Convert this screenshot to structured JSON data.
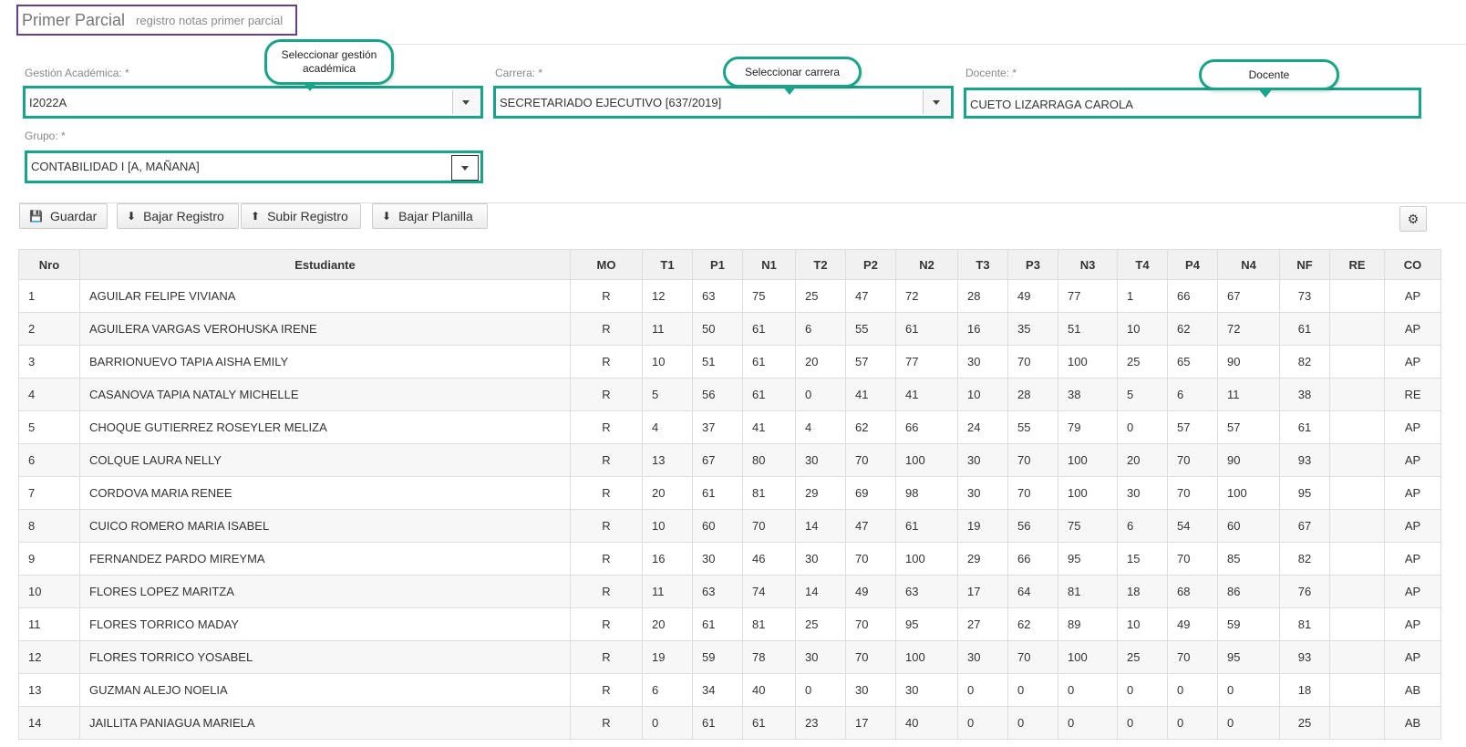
{
  "header": {
    "title": "Primer Parcial",
    "subtitle": "registro notas primer parcial"
  },
  "form": {
    "gestion": {
      "label": "Gestión Académica:  *",
      "value": "I2022A"
    },
    "carrera": {
      "label": "Carrera:  *",
      "value": "SECRETARIADO EJECUTIVO [637/2019]"
    },
    "docente": {
      "label": "Docente:  *",
      "value": "CUETO LIZARRAGA  CAROLA"
    },
    "grupo": {
      "label": "Grupo:  *",
      "value": "CONTABILIDAD I [A, MAÑANA]"
    }
  },
  "callouts": {
    "gestion": "Seleccionar gestión académica",
    "carrera": "Seleccionar carrera",
    "docente": "Docente"
  },
  "toolbar": {
    "guardar": "Guardar",
    "bajar_registro": "Bajar Registro",
    "subir_registro": "Subir Registro",
    "bajar_planilla": "Bajar Planilla"
  },
  "table": {
    "columns": [
      "Nro",
      "Estudiante",
      "MO",
      "T1",
      "P1",
      "N1",
      "T2",
      "P2",
      "N2",
      "T3",
      "P3",
      "N3",
      "T4",
      "P4",
      "N4",
      "NF",
      "RE",
      "CO"
    ],
    "rows": [
      [
        "1",
        "AGUILAR FELIPE VIVIANA",
        "R",
        "12",
        "63",
        "75",
        "25",
        "47",
        "72",
        "28",
        "49",
        "77",
        "1",
        "66",
        "67",
        "73",
        "",
        "AP"
      ],
      [
        "2",
        "AGUILERA VARGAS VEROHUSKA IRENE",
        "R",
        "11",
        "50",
        "61",
        "6",
        "55",
        "61",
        "16",
        "35",
        "51",
        "10",
        "62",
        "72",
        "61",
        "",
        "AP"
      ],
      [
        "3",
        "BARRIONUEVO TAPIA AISHA EMILY",
        "R",
        "10",
        "51",
        "61",
        "20",
        "57",
        "77",
        "30",
        "70",
        "100",
        "25",
        "65",
        "90",
        "82",
        "",
        "AP"
      ],
      [
        "4",
        "CASANOVA TAPIA NATALY MICHELLE",
        "R",
        "5",
        "56",
        "61",
        "0",
        "41",
        "41",
        "10",
        "28",
        "38",
        "5",
        "6",
        "11",
        "38",
        "",
        "RE"
      ],
      [
        "5",
        "CHOQUE GUTIERREZ ROSEYLER MELIZA",
        "R",
        "4",
        "37",
        "41",
        "4",
        "62",
        "66",
        "24",
        "55",
        "79",
        "0",
        "57",
        "57",
        "61",
        "",
        "AP"
      ],
      [
        "6",
        "COLQUE LAURA NELLY",
        "R",
        "13",
        "67",
        "80",
        "30",
        "70",
        "100",
        "30",
        "70",
        "100",
        "20",
        "70",
        "90",
        "93",
        "",
        "AP"
      ],
      [
        "7",
        "CORDOVA MARIA RENEE",
        "R",
        "20",
        "61",
        "81",
        "29",
        "69",
        "98",
        "30",
        "70",
        "100",
        "30",
        "70",
        "100",
        "95",
        "",
        "AP"
      ],
      [
        "8",
        "CUICO ROMERO MARIA ISABEL",
        "R",
        "10",
        "60",
        "70",
        "14",
        "47",
        "61",
        "19",
        "56",
        "75",
        "6",
        "54",
        "60",
        "67",
        "",
        "AP"
      ],
      [
        "9",
        "FERNANDEZ PARDO MIREYMA",
        "R",
        "16",
        "30",
        "46",
        "30",
        "70",
        "100",
        "29",
        "66",
        "95",
        "15",
        "70",
        "85",
        "82",
        "",
        "AP"
      ],
      [
        "10",
        "FLORES LOPEZ MARITZA",
        "R",
        "11",
        "63",
        "74",
        "14",
        "49",
        "63",
        "17",
        "64",
        "81",
        "18",
        "68",
        "86",
        "76",
        "",
        "AP"
      ],
      [
        "11",
        "FLORES TORRICO MADAY",
        "R",
        "20",
        "61",
        "81",
        "25",
        "70",
        "95",
        "27",
        "62",
        "89",
        "10",
        "49",
        "59",
        "81",
        "",
        "AP"
      ],
      [
        "12",
        "FLORES TORRICO YOSABEL",
        "R",
        "19",
        "59",
        "78",
        "30",
        "70",
        "100",
        "30",
        "70",
        "100",
        "25",
        "70",
        "95",
        "93",
        "",
        "AP"
      ],
      [
        "13",
        "GUZMAN ALEJO NOELIA",
        "R",
        "6",
        "34",
        "40",
        "0",
        "30",
        "30",
        "0",
        "0",
        "0",
        "0",
        "0",
        "0",
        "18",
        "",
        "AB"
      ],
      [
        "14",
        "JAILLITA PANIAGUA MARIELA",
        "R",
        "0",
        "61",
        "61",
        "23",
        "17",
        "40",
        "0",
        "0",
        "0",
        "0",
        "0",
        "0",
        "25",
        "",
        "AB"
      ]
    ]
  }
}
